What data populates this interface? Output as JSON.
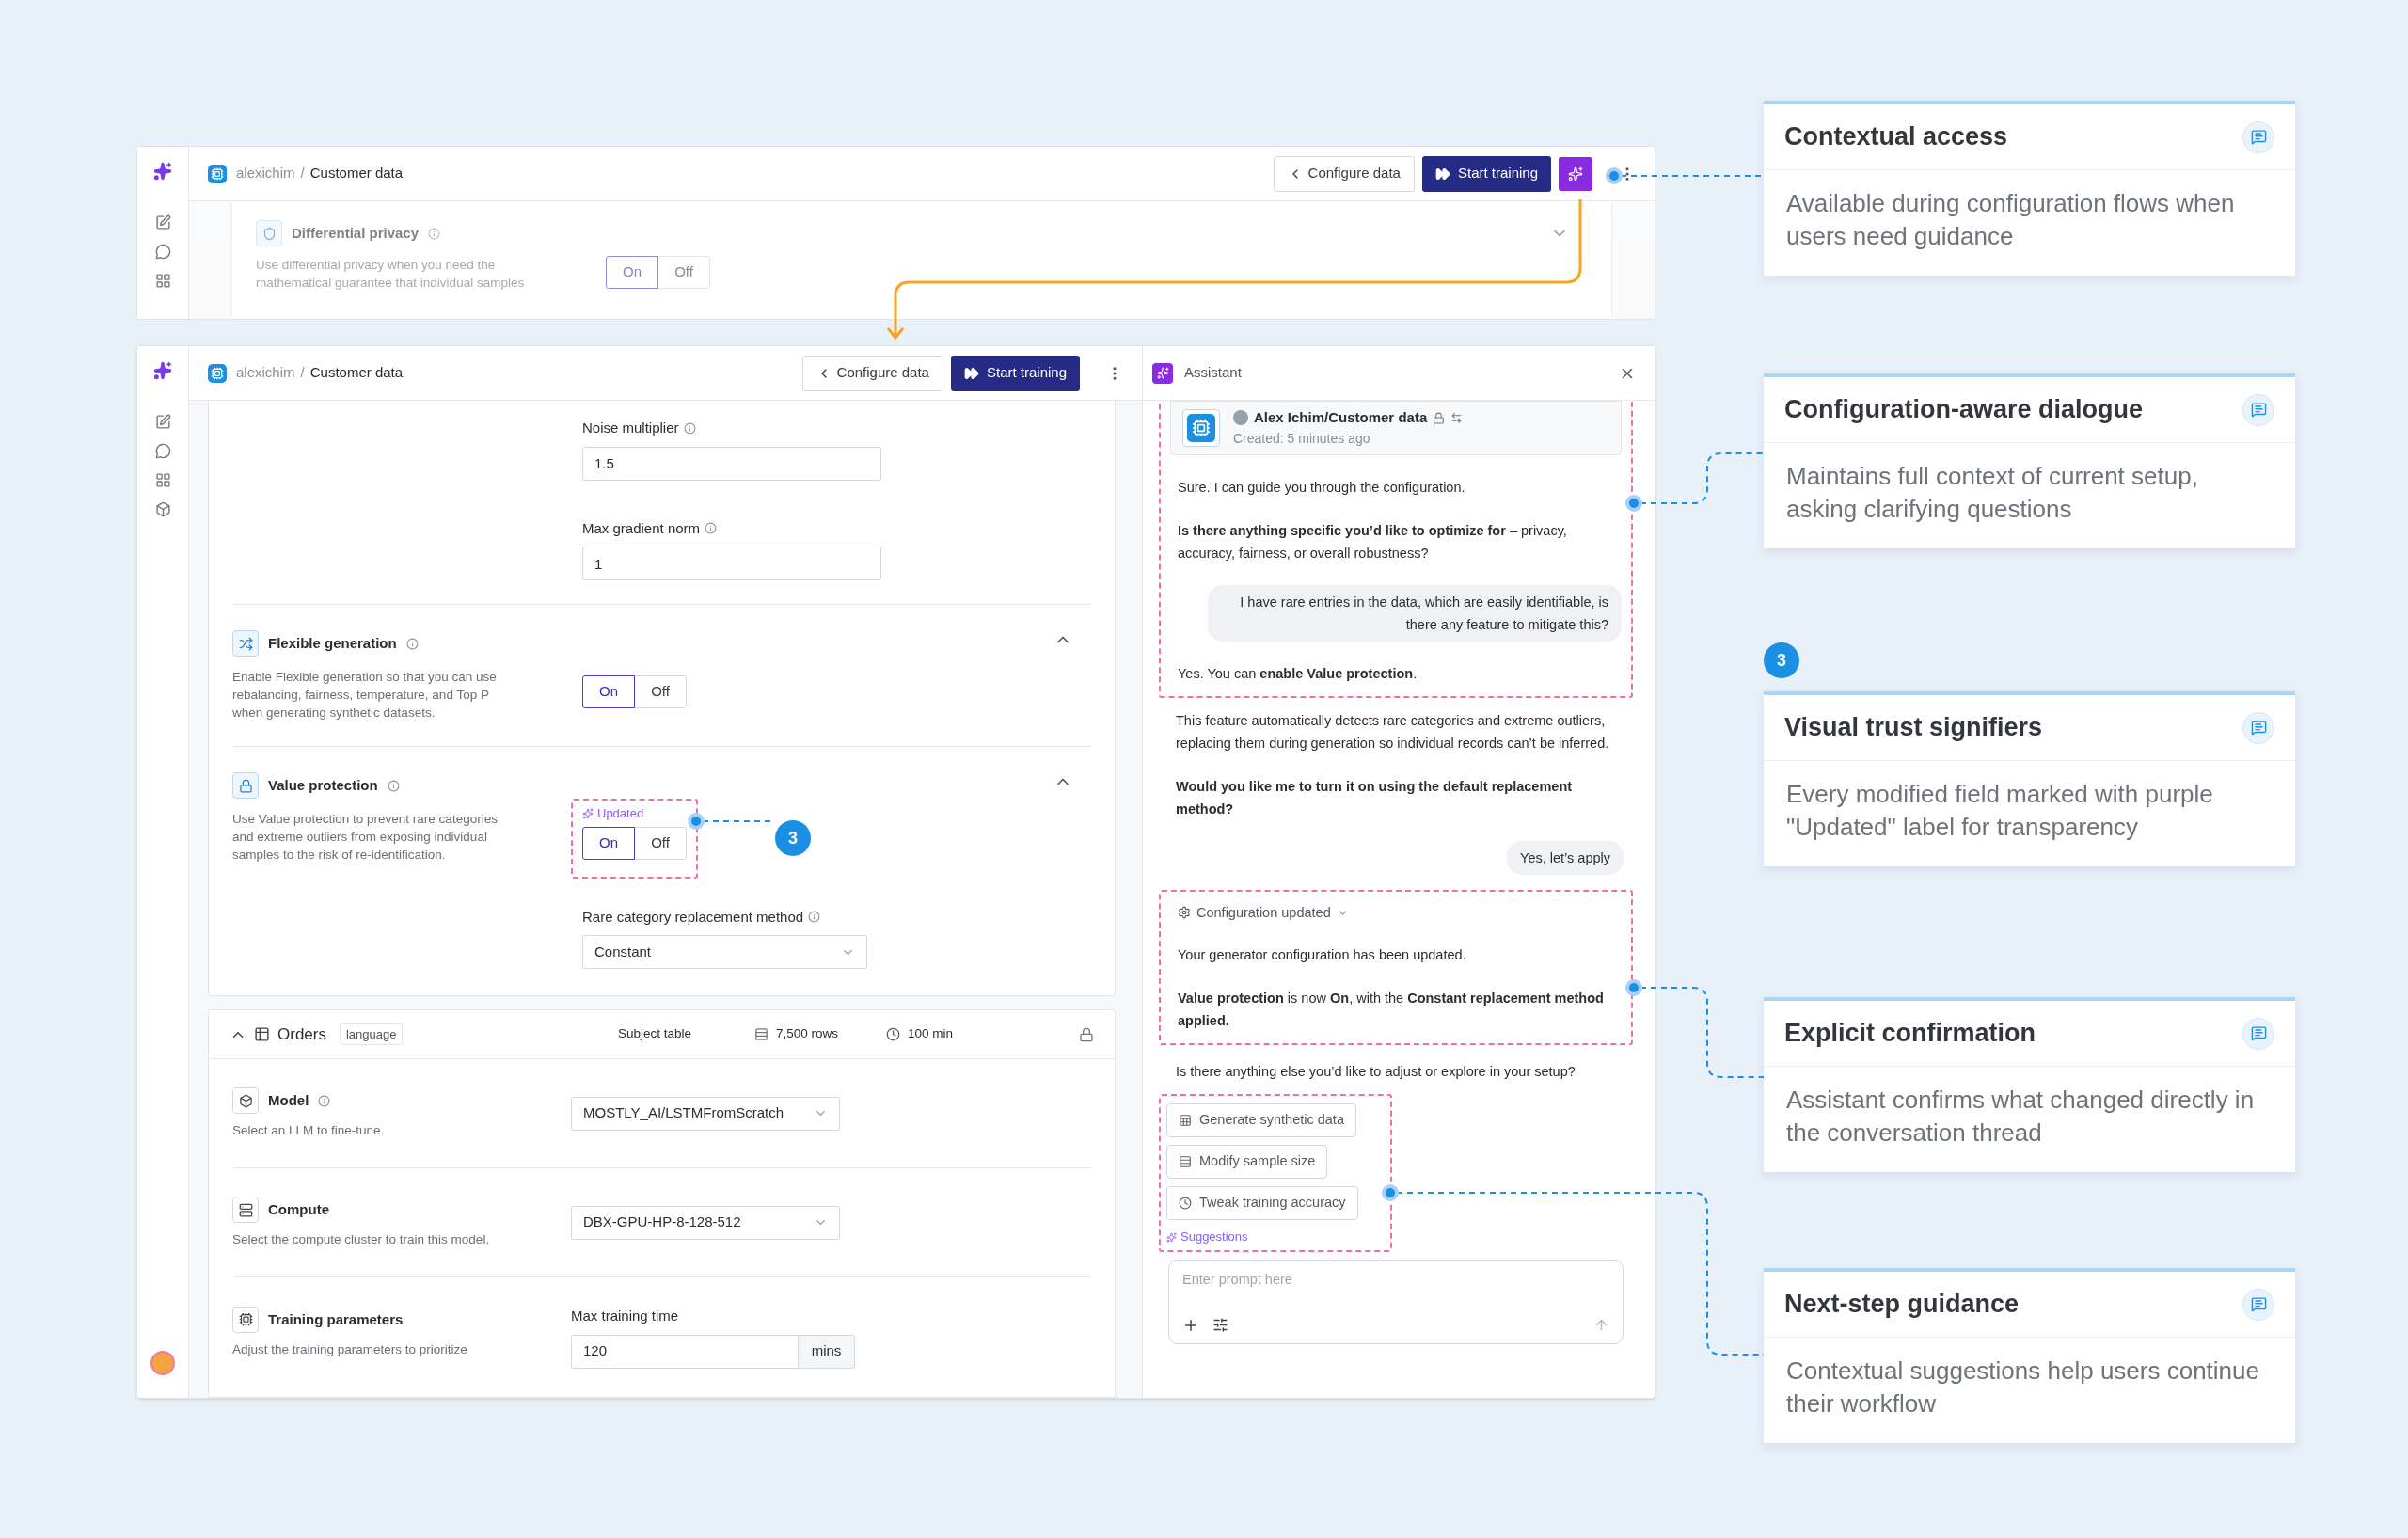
{
  "top_window": {
    "breadcrumb": {
      "owner": "alexichim",
      "separator": "/",
      "page": "Customer data"
    },
    "back_button": "Configure data",
    "primary_button": "Start training",
    "assistant_button": {
      "selected": true
    },
    "section": {
      "title": "Differential privacy",
      "description": "Use differential privacy when you need the mathematical guarantee that individual samples",
      "options": [
        {
          "label": "On",
          "selected": true
        },
        {
          "label": "Off",
          "selected": false
        }
      ]
    }
  },
  "main_window": {
    "breadcrumb": {
      "owner": "alexichim",
      "separator": "/",
      "page": "Customer data"
    },
    "back_button": "Configure data",
    "primary_button": "Start training",
    "fields": [
      {
        "label": "Noise multiplier",
        "value": "1.5"
      },
      {
        "label": "Max gradient norm",
        "value": "1"
      }
    ],
    "sections": [
      {
        "title": "Flexible generation",
        "description": "Enable Flexible generation so that you can use rebalancing, fairness, temperature, and Top P when generating synthetic datasets.",
        "expanded": true,
        "updated": false,
        "options": [
          {
            "label": "On",
            "selected": true
          },
          {
            "label": "Off",
            "selected": false
          }
        ]
      },
      {
        "title": "Value protection",
        "description": "Use Value protection to prevent rare categories and extreme outliers from exposing individual samples to the risk of re-identification.",
        "expanded": true,
        "updated": true,
        "updated_label": "Updated",
        "badge": "3",
        "options": [
          {
            "label": "On",
            "selected": true
          },
          {
            "label": "Off",
            "selected": false
          }
        ]
      }
    ],
    "replacement": {
      "label": "Rare category replacement method",
      "value": "Constant"
    },
    "table": {
      "expanded": true,
      "name": "Orders",
      "tag": "language",
      "type": "Subject table",
      "rows": "7,500 rows",
      "duration": "100 min"
    },
    "settings": [
      {
        "kind": "select",
        "title": "Model",
        "info": true,
        "description": "Select an LLM to fine-tune.",
        "value": "MOSTLY_AI/LSTMFromScratch"
      },
      {
        "kind": "select",
        "title": "Compute",
        "info": false,
        "description": "Select the compute cluster to train this model.",
        "value": "DBX-GPU-HP-8-128-512"
      },
      {
        "kind": "number",
        "title": "Training parameters",
        "info": false,
        "description": "Adjust the training parameters to prioritize",
        "field_label": "Max training time",
        "value": "120",
        "unit": "mins"
      }
    ]
  },
  "assistant": {
    "title": "Assistant",
    "context": {
      "title": "Alex Ichim/Customer data",
      "meta": "Created: 5 minutes ago"
    },
    "blocks": [
      {
        "highlighted": true,
        "messages": [
          {
            "kind": "assistant",
            "text": "Sure. I can guide you through the configuration."
          },
          {
            "kind": "assistant",
            "text": "**Is there anything specific you’d like to optimize for** – privacy, accuracy, fairness, or overall robustness?"
          },
          {
            "kind": "user",
            "text": "I have rare entries in the data, which are easily identifiable, is there any feature to mitigate this?"
          },
          {
            "kind": "assistant",
            "text": "Yes. You can **enable Value protection**."
          }
        ]
      },
      {
        "highlighted": false,
        "messages": [
          {
            "kind": "assistant",
            "text": "This feature automatically detects rare categories and extreme outliers, replacing them during generation so individual records can’t be inferred."
          },
          {
            "kind": "question",
            "text": "Would you like me to turn it on using the default replacement method?"
          },
          {
            "kind": "user",
            "text": "Yes, let’s apply"
          }
        ]
      },
      {
        "highlighted": true,
        "messages": [
          {
            "kind": "update",
            "text": "Configuration updated"
          },
          {
            "kind": "assistant",
            "text": "Your generator configuration has been updated."
          },
          {
            "kind": "assistant",
            "text": "**Value protection** is now **On**, with the **Constant replacement method applied.**"
          }
        ]
      },
      {
        "highlighted": false,
        "messages": [
          {
            "kind": "assistant",
            "text": "Is there anything else you’d like to adjust or explore in your setup?"
          }
        ]
      }
    ],
    "suggestions": {
      "label": "Suggestions",
      "items": [
        "Generate synthetic data",
        "Modify sample size",
        "Tweak training accuracy"
      ]
    },
    "input": {
      "placeholder": "Enter prompt here"
    }
  },
  "callouts": [
    {
      "title": "Contextual access",
      "text": "Available during configuration flows when users need guidance"
    },
    {
      "title": "Configuration-aware dialogue",
      "text": "Maintains full context of current setup, asking clarifying questions"
    },
    {
      "title": "Visual trust signifiers",
      "text": "Every modified field marked with purple \"Updated\" label for transparency",
      "badge": "3"
    },
    {
      "title": "Explicit confirmation",
      "text": "Assistant confirms what changed directly in the conversation thread"
    },
    {
      "title": "Next-step guidance",
      "text": "Contextual suggestions help users continue their workflow"
    }
  ]
}
